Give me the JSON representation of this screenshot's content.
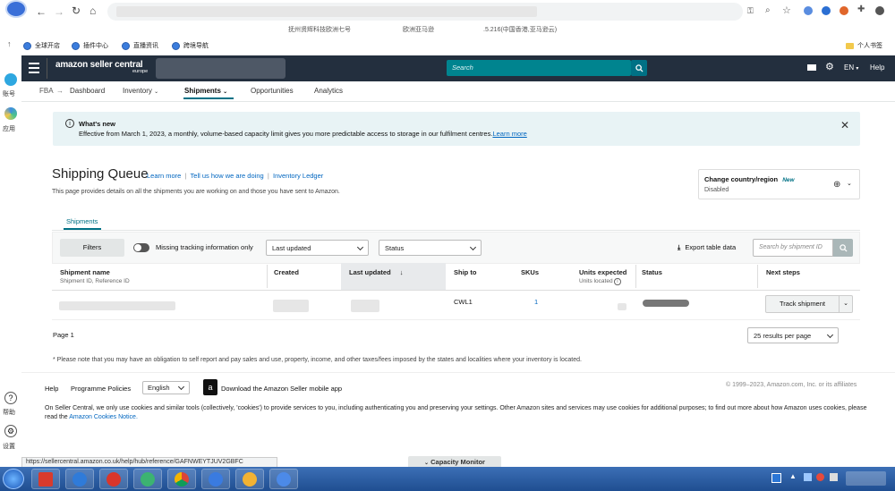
{
  "browser": {
    "bookmarks": [
      "全球开店",
      "插件中心",
      "直播资讯",
      "跨境导航"
    ],
    "bookmark_right": "个人书签",
    "tab_strip_texts": [
      "抚州贤辉科技欧洲七号",
      "欧洲亚马逊",
      ".5.216(中国香港,亚马逊云)"
    ]
  },
  "sidebar": {
    "items": [
      {
        "label": "账号",
        "icon": "account-icon"
      },
      {
        "label": "应用",
        "icon": "apps-icon"
      },
      {
        "label": "帮助",
        "icon": "help-icon"
      },
      {
        "label": "设置",
        "icon": "settings-icon"
      }
    ]
  },
  "header": {
    "logo_text": "amazon seller central",
    "logo_sub": "europe",
    "search_placeholder": "Search",
    "language": "EN",
    "help_label": "Help"
  },
  "nav": {
    "items": [
      "FBA",
      "Dashboard",
      "Inventory",
      "Shipments",
      "Opportunities",
      "Analytics"
    ]
  },
  "notice": {
    "title": "What's new",
    "body": "Effective from March 1, 2023, a monthly, volume-based capacity limit gives you more predictable access to storage in our fulfilment centres.",
    "link": "Learn more"
  },
  "page": {
    "title": "Shipping Queue",
    "links": [
      "Learn more",
      "Tell us how we are doing",
      "Inventory Ledger"
    ],
    "description": "This page provides details on all the shipments you are working on and those you have sent to Amazon.",
    "country_box": {
      "title": "Change country/region",
      "badge": "New",
      "value": "Disabled"
    },
    "tab": "Shipments"
  },
  "filters": {
    "filters_button": "Filters",
    "toggle_label": "Missing tracking information only",
    "sort_select": "Last updated",
    "status_select": "Status",
    "export_label": "Export table data",
    "search_placeholder": "Search by shipment ID"
  },
  "table": {
    "headers": {
      "name": "Shipment name",
      "name_sub": "Shipment ID, Reference ID",
      "created": "Created",
      "updated": "Last updated",
      "ship_to": "Ship to",
      "skus": "SKUs",
      "units": "Units expected",
      "units_sub": "Units located",
      "status": "Status",
      "next": "Next steps"
    },
    "rows": [
      {
        "ship_to": "CWL1",
        "skus": "1",
        "action": "Track shipment"
      }
    ]
  },
  "pagination": {
    "page_label": "Page 1",
    "per_page": "25 results per page"
  },
  "footnote": "* Please note that you may have an obligation to self report and pay sales and use, property, income, and other taxes/fees imposed by the states and localities where your inventory is located.",
  "footer": {
    "help": "Help",
    "policies": "Programme Policies",
    "language_select": "English",
    "app_link": "Download the Amazon Seller mobile app",
    "copyright": "© 1999–2023, Amazon.com, Inc. or its affiliates",
    "cookies_text": "On Seller Central, we only use cookies and similar tools (collectively, 'cookies') to provide services to you, including authenticating you and preserving your settings. Other Amazon sites and services may use cookies for additional purposes; to find out more about how Amazon uses cookies, please read the",
    "cookies_link": "Amazon Cookies Notice."
  },
  "status_bar": {
    "url": "https://sellercentral.amazon.co.uk/help/hub/reference/GAFNWEYTJUV2GBFC",
    "capacity_monitor": "Capacity Monitor"
  },
  "colors": {
    "header_bg": "#232f3e",
    "search_bg": "#00848f",
    "notice_bg": "#e8f3f5",
    "link": "#0066c0",
    "taskbar": "#2a5ea4"
  }
}
